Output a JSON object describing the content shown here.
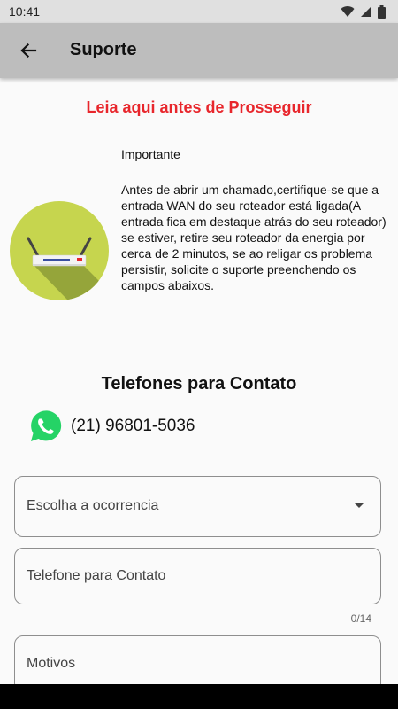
{
  "status_bar": {
    "time": "10:41",
    "icons": [
      "wifi-icon",
      "signal-icon",
      "battery-icon"
    ]
  },
  "app_bar": {
    "title": "Suporte",
    "back_icon": "arrow-back-icon"
  },
  "notice": {
    "heading": "Leia aqui antes de Prosseguir",
    "important_label": "Importante",
    "body": "Antes de abrir um chamado,certifique-se que a entrada WAN do seu roteador está ligada(A entrada fica em destaque atrás do seu roteador) se estiver, retire seu roteador da energia por cerca de 2 minutos, se ao religar os problema persistir, solicite o suporte preenchendo os campos abaixos.",
    "illustration_icon": "router-icon"
  },
  "contacts": {
    "title": "Telefones para Contato",
    "phone_icon": "whatsapp-icon",
    "phone": "(21) 96801-5036"
  },
  "form": {
    "occurrence_placeholder": "Escolha a ocorrencia",
    "phone_placeholder": "Telefone para Contato",
    "phone_counter": "0/14",
    "reasons_placeholder": "Motivos"
  },
  "colors": {
    "app_bar": "#bdbdbd",
    "warning": "#e8262c",
    "router_circle": "#c6d54e",
    "whatsapp": "#25d366",
    "background": "#fafafa"
  }
}
